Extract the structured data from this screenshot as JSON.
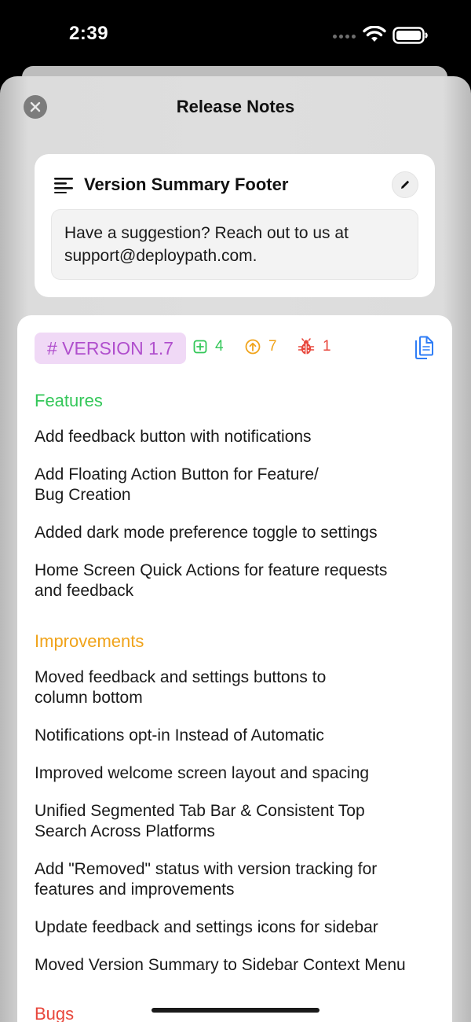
{
  "status_bar": {
    "time": "2:39"
  },
  "sheet": {
    "title": "Release Notes"
  },
  "summary_card": {
    "title": "Version Summary Footer",
    "body_line1": "Have a suggestion? Reach out to us at",
    "body_line2": "support@deploypath.com."
  },
  "version": {
    "tag": "# VERSION 1.7",
    "counts": {
      "features": "4",
      "improvements": "7",
      "bugs": "1"
    },
    "sections": {
      "features": {
        "title": "Features",
        "items": [
          [
            "Add feedback button with notifications"
          ],
          [
            "Add Floating Action Button for Feature/",
            "Bug Creation"
          ],
          [
            "Added dark mode preference toggle to settings"
          ],
          [
            "Home Screen Quick Actions for feature requests",
            "and feedback"
          ]
        ]
      },
      "improvements": {
        "title": "Improvements",
        "items": [
          [
            "Moved feedback and settings buttons to",
            "column bottom"
          ],
          [
            "Notifications opt-in Instead of Automatic"
          ],
          [
            "Improved welcome screen layout and spacing"
          ],
          [
            "Unified Segmented Tab Bar & Consistent Top",
            "Search Across Platforms"
          ],
          [
            "Add \"Removed\" status with version tracking for",
            "features and improvements"
          ],
          [
            "Update feedback and settings icons for sidebar"
          ],
          [
            "Moved Version Summary to Sidebar Context Menu"
          ]
        ]
      },
      "bugs": {
        "title": "Bugs"
      }
    }
  },
  "colors": {
    "features": "#34c759",
    "improvements": "#f0a31a",
    "bugs": "#e8473c",
    "version_tag_bg": "#f0d9f6",
    "version_tag_text": "#b04fcd",
    "copy_icon": "#2f7df6"
  },
  "icons": {
    "close": "xmark-icon",
    "summary": "text-lines-icon",
    "edit": "pencil-icon",
    "features_count": "plus-square-icon",
    "improvements_count": "arrow-up-circle-icon",
    "bugs_count": "ladybug-icon",
    "copy": "copy-documents-icon"
  }
}
